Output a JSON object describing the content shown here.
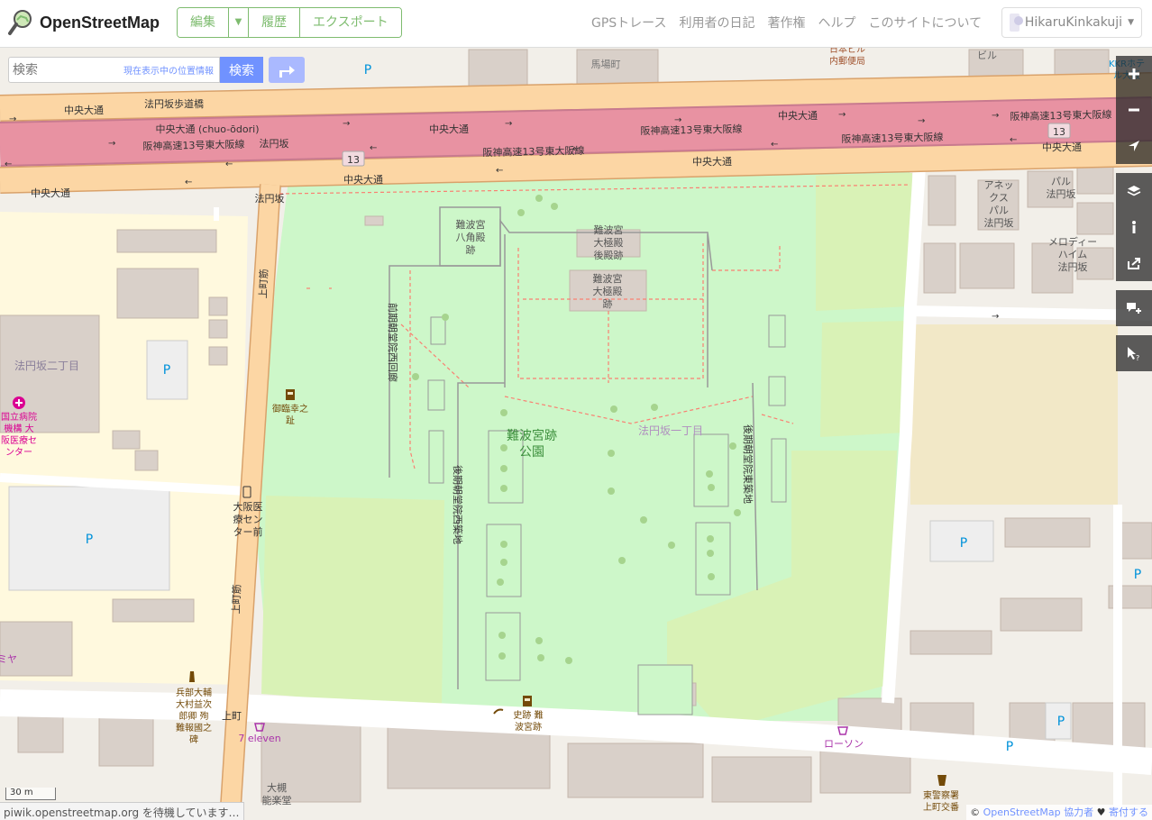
{
  "header": {
    "logo_text": "OpenStreetMap",
    "edit_label": "編集",
    "history_label": "履歴",
    "export_label": "エクスポート",
    "nav": [
      "GPSトレース",
      "利用者の日記",
      "著作権",
      "ヘルプ",
      "このサイトについて"
    ],
    "username": "HikaruKinkakuji"
  },
  "search": {
    "placeholder": "検索",
    "where_link": "現在表示中の位置情報",
    "button": "検索"
  },
  "map_labels": {
    "park": "難波宮跡\n公園",
    "hakkaku": "難波宮\n八角殿\n跡",
    "koden": "難波宮\n大極殿\n後殿跡",
    "daigokuden": "難波宮\n大極殿\n跡",
    "hoenzaka1": "法円坂一丁目",
    "hoenzaka2": "法円坂二丁目",
    "baba": "馬場町",
    "nissei": "日本ビル\n内郵便局",
    "building": "ビル",
    "kkr": "KKRホテ\nル大阪",
    "chuo": "中央大通",
    "chuo_roman": "中央大通 (chuo-ōdori)",
    "hanshin": "阪神高速13号東大阪線",
    "hoenzaka_st": "法円坂",
    "hoenzaka_bashi": "法円坂歩道橋",
    "uemachi": "上町筋",
    "uemachi_st": "上町",
    "route": "13",
    "west_corridor": "前期朝堂院西回廊",
    "west_ruin": "後期朝堂院西築地",
    "east_ruin": "後期朝堂院東築地",
    "goringo": "御臨幸之\n趾",
    "hospital": "国立病院\n機構 大\n阪医療セ\nンター",
    "busstop": "大阪医\n療セン\nター前",
    "annex": "アネッ\nクス\nパル\n法円坂",
    "paru": "パル\n法円坂",
    "melody": "メロディー\nハイム\n法円坂",
    "monument": "兵部大輔\n大村益次\n郎卿 殉\n難報國之\n碑",
    "shiseki": "史跡 難\n波宮跡",
    "seven": "7 eleven",
    "lawson": "ローソン",
    "police": "東警察署\n上町交番",
    "omiya": "ミヤ",
    "taiju": "大槻\n能楽堂",
    "parking": "P"
  },
  "scale_label": "30 m",
  "status_text": "piwik.openstreetmap.org を待機しています…",
  "attribution": {
    "prefix": "©",
    "osm": "OpenStreetMap",
    "contrib": "協力者",
    "heart": "♥",
    "donate": "寄付する"
  },
  "colors": {
    "brand_green": "#7ebc6f",
    "button_blue": "#7092ff",
    "motorway": "#e892a2",
    "trunk": "#fcd6a4",
    "park": "#cdf7c9",
    "residential": "#fff9de"
  }
}
